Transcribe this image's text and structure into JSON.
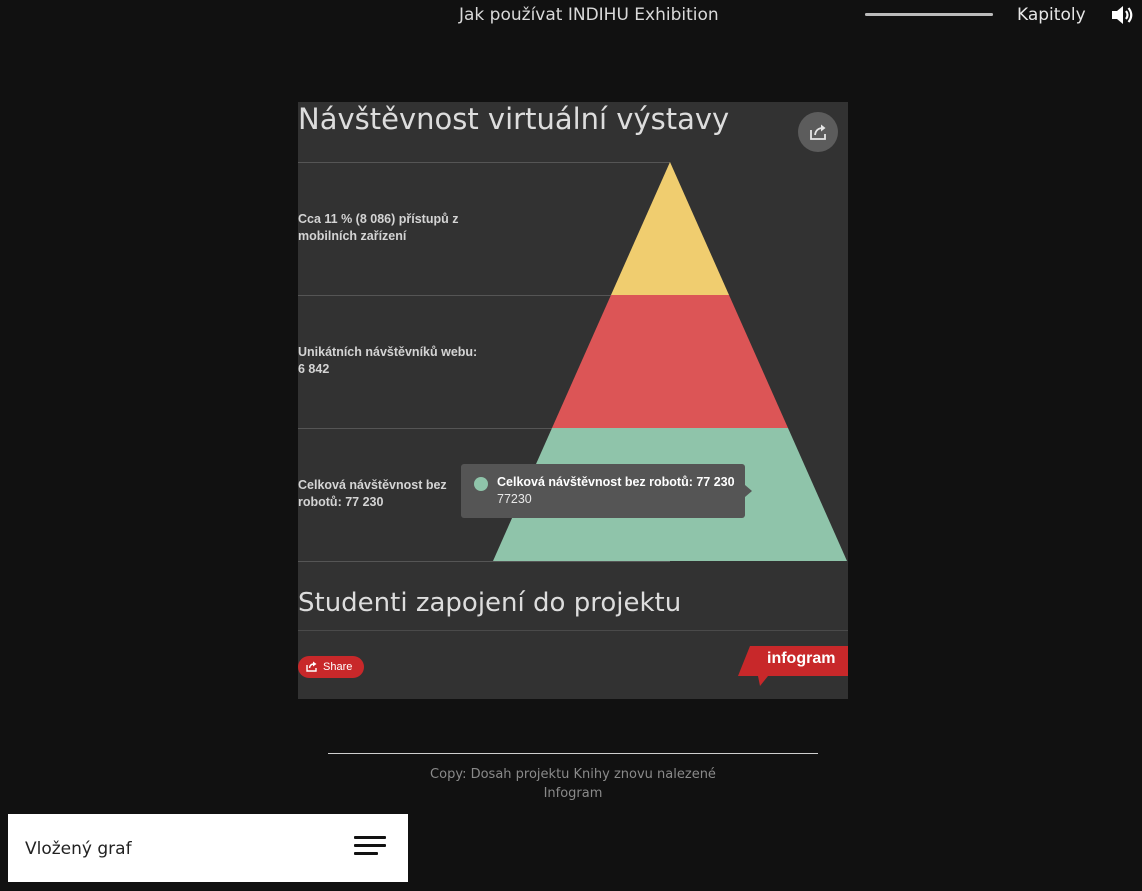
{
  "header": {
    "title": "Jak používat INDIHU Exhibition",
    "chapters_label": "Kapitoly",
    "progress_fraction": 1.0,
    "icons": {
      "volume": "volume-icon"
    }
  },
  "embed": {
    "title": "Návštěvnost virtuální výstavy",
    "subtitle": "Studenti zapojení do projektu",
    "share_label": "Share",
    "brand_label": "infogram",
    "colors": {
      "panel": "#323232",
      "brand": "#c8282a"
    },
    "tooltip": {
      "title": "Celková návštěvnost bez robotů: 77 230",
      "value": "77230"
    }
  },
  "chart_data": {
    "type": "pyramid",
    "title": "Návštěvnost virtuální výstavy",
    "levels": [
      {
        "label_lines": [
          "Cca 11 % (8 086) přístupů z",
          "mobilních zařízení"
        ],
        "value": 8086,
        "color": "#f0cd6f"
      },
      {
        "label_lines": [
          "Unikátních návštěvníků webu:",
          "6 842"
        ],
        "value": 6842,
        "color": "#dc5556"
      },
      {
        "label_lines": [
          "Celková návštěvnost bez",
          "robotů: 77 230"
        ],
        "value": 77230,
        "color": "#8fc4aa"
      }
    ]
  },
  "caption": {
    "line1": "Copy: Dosah projektu Knihy znovu nalezené",
    "line2": "Infogram"
  },
  "footer": {
    "label": "Vložený graf"
  }
}
